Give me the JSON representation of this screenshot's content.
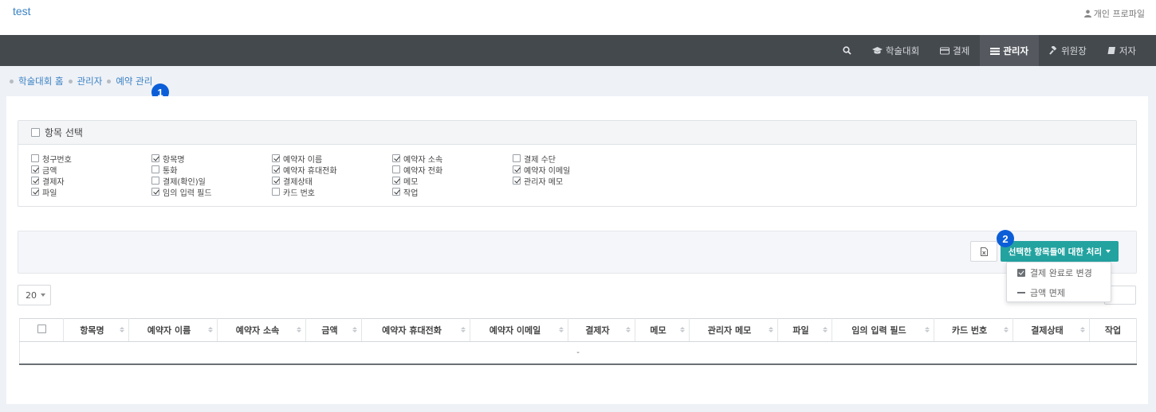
{
  "app": {
    "title": "test",
    "profile_label": "개인 프로파일"
  },
  "nav": {
    "items": [
      {
        "label": "학술대회",
        "icon": "graduation-cap-icon"
      },
      {
        "label": "결제",
        "icon": "credit-card-icon"
      },
      {
        "label": "관리자",
        "icon": "list-icon",
        "active": true
      },
      {
        "label": "위원장",
        "icon": "gavel-icon"
      },
      {
        "label": "저자",
        "icon": "book-icon"
      }
    ]
  },
  "breadcrumb": [
    "학술대회 홈",
    "관리자",
    "예약 관리"
  ],
  "badges": [
    "1",
    "2"
  ],
  "column_panel": {
    "title": "항목 선택",
    "options": [
      {
        "label": "청구번호",
        "checked": false
      },
      {
        "label": "항목명",
        "checked": true
      },
      {
        "label": "예약자 이름",
        "checked": true
      },
      {
        "label": "예약자 소속",
        "checked": true
      },
      {
        "label": "결제 수단",
        "checked": false
      },
      {
        "label": "금액",
        "checked": true
      },
      {
        "label": "통화",
        "checked": false
      },
      {
        "label": "예약자 휴대전화",
        "checked": true
      },
      {
        "label": "예약자 전화",
        "checked": false
      },
      {
        "label": "예약자 이메일",
        "checked": true
      },
      {
        "label": "결제자",
        "checked": true
      },
      {
        "label": "결제(확인)일",
        "checked": false
      },
      {
        "label": "결제상태",
        "checked": true
      },
      {
        "label": "메모",
        "checked": true
      },
      {
        "label": "관리자 메모",
        "checked": true
      },
      {
        "label": "파일",
        "checked": true
      },
      {
        "label": "임의 입력 필드",
        "checked": true
      },
      {
        "label": "카드 번호",
        "checked": false
      },
      {
        "label": "작업",
        "checked": true
      }
    ]
  },
  "toolbar": {
    "action_label": "선택한 항목들에 대한 처리",
    "dropdown": [
      "결제 완료로 변경",
      "금액 면제"
    ]
  },
  "page_size": "20",
  "table": {
    "columns": [
      "항목명",
      "예약자 이름",
      "예약자 소속",
      "금액",
      "예약자 휴대전화",
      "예약자 이메일",
      "결제자",
      "메모",
      "관리자 메모",
      "파일",
      "임의 입력 필드",
      "카드 번호",
      "결제상태",
      "작업"
    ],
    "empty_text": "-"
  },
  "colors": {
    "accent": "#23a3a0",
    "navbar": "#44494e",
    "badge": "#0b5ed7",
    "link": "#3b82c4"
  }
}
